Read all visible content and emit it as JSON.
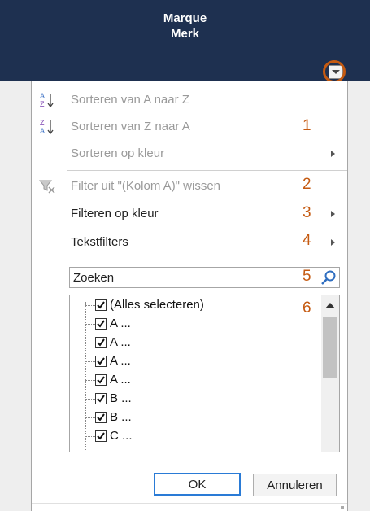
{
  "header": {
    "line1": "Marque",
    "line2": "Merk"
  },
  "menu": {
    "sort_az": "Sorteren van A naar Z",
    "sort_za": "Sorteren van Z naar A",
    "sort_color": "Sorteren op kleur",
    "clear_filter": "Filter uit \"(Kolom A)\" wissen",
    "filter_color": "Filteren op kleur",
    "text_filters": "Tekstfilters"
  },
  "search": {
    "placeholder": "Zoeken"
  },
  "list": {
    "items": [
      "(Alles selecteren)",
      "A ...",
      "A ...",
      "A ...",
      "A ...",
      "B ...",
      "B ...",
      "C ..."
    ]
  },
  "buttons": {
    "ok": "OK",
    "cancel": "Annuleren"
  },
  "callouts": [
    "1",
    "2",
    "3",
    "4",
    "5",
    "6"
  ],
  "colors": {
    "header_bg": "#1e3050",
    "callout": "#c55a11",
    "ok_border": "#2a7bd6"
  }
}
